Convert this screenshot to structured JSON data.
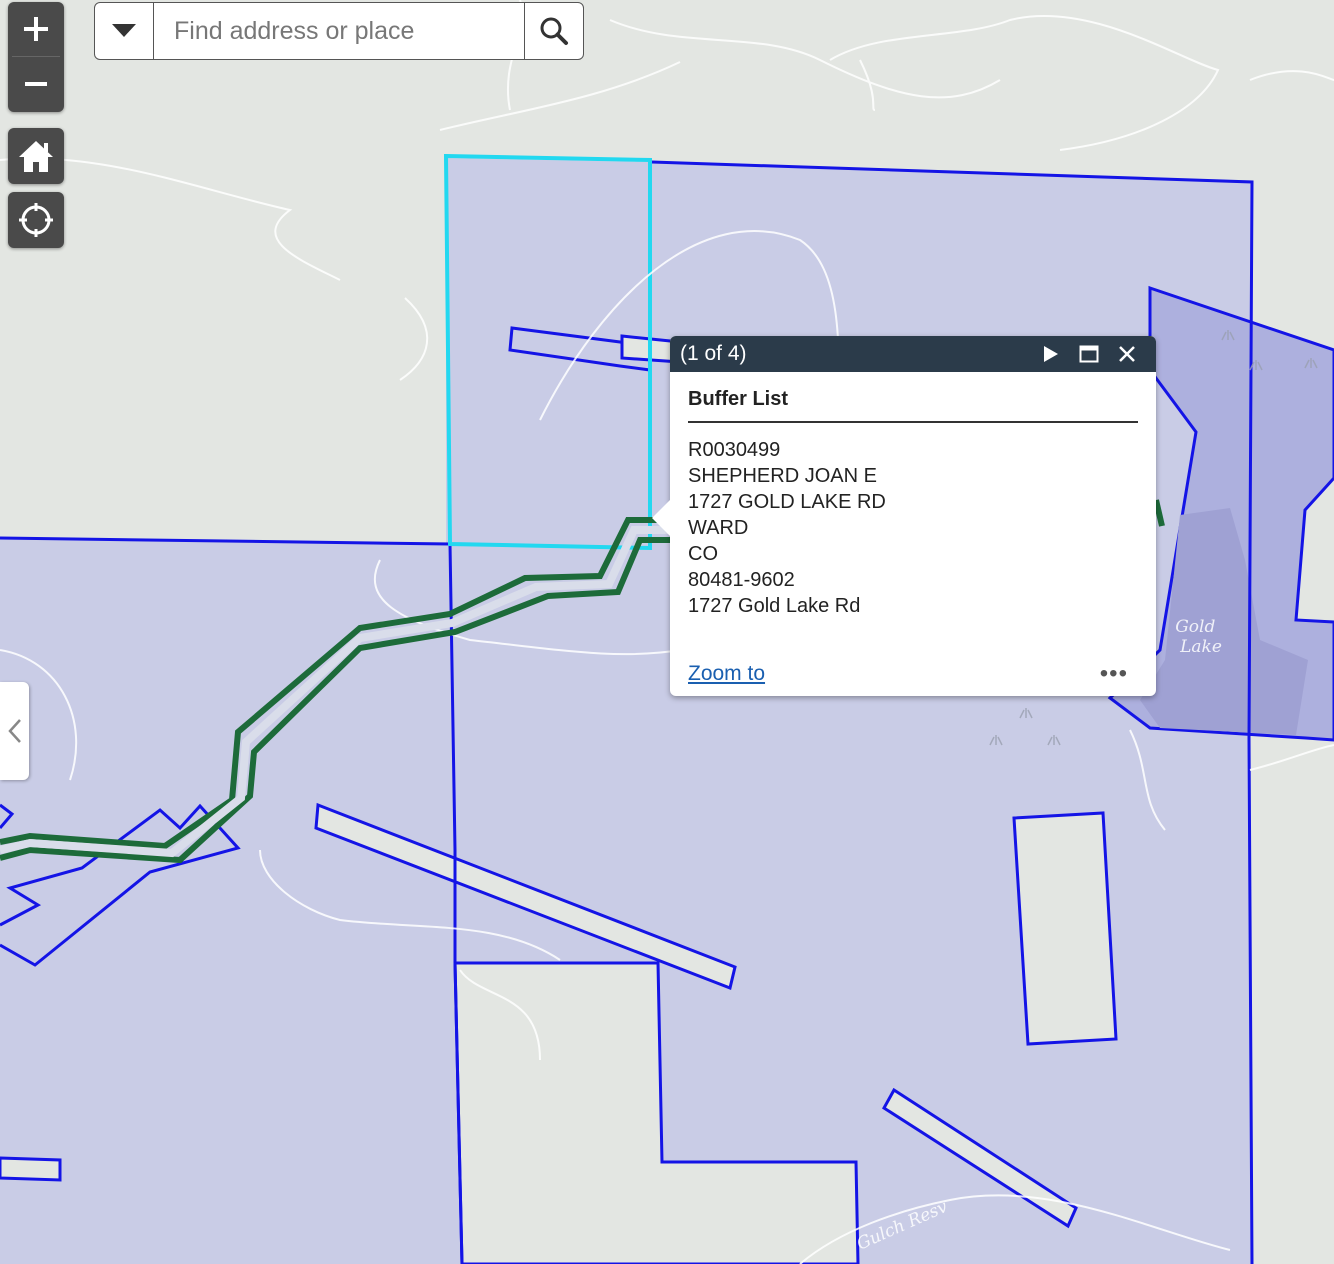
{
  "map": {
    "labels": {
      "lake": "Gold Lake",
      "reservoir": "Gulch Resv"
    },
    "colors": {
      "basemap": "#e3e6e2",
      "parcel_fill": "#c9cce6",
      "parcel_outline": "#1414e6",
      "selected_outline": "#22d8f0",
      "buffer_line": "#1d6b3a",
      "lake_fill": "#a6a8d8",
      "road": "#ffffff"
    }
  },
  "controls": {
    "zoom_in_icon": "plus-icon",
    "zoom_out_icon": "minus-icon",
    "home_icon": "home-icon",
    "locate_icon": "crosshair-icon"
  },
  "search": {
    "placeholder": "Find address or place",
    "value": ""
  },
  "popup": {
    "count": "(1 of 4)",
    "title": "Buffer List",
    "lines": [
      "R0030499",
      "SHEPHERD JOAN E",
      "1727 GOLD LAKE RD",
      "WARD",
      "CO",
      "80481-9602",
      "1727 Gold Lake Rd"
    ],
    "zoom_to": "Zoom to",
    "more": "•••"
  }
}
